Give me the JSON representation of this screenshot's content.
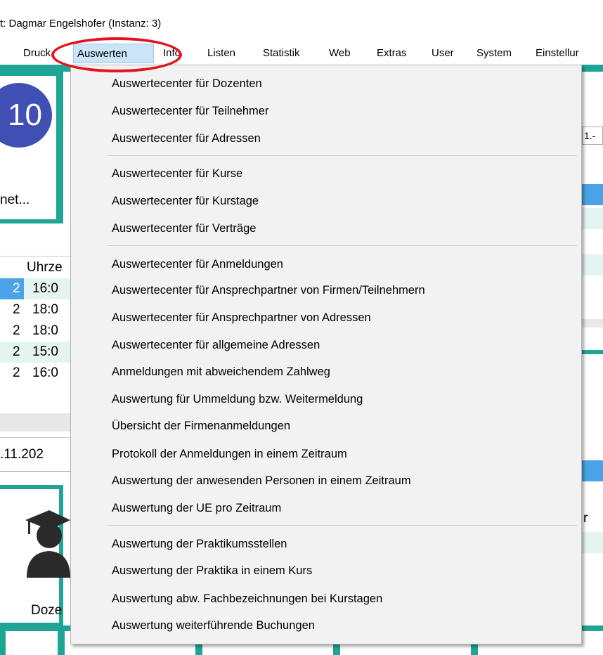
{
  "window": {
    "title": "t: Dagmar Engelshofer (Instanz: 3)"
  },
  "menubar": {
    "items": [
      {
        "label": "Druck"
      },
      {
        "label": "Auswerten"
      },
      {
        "label": "Info"
      },
      {
        "label": "Listen"
      },
      {
        "label": "Statistik"
      },
      {
        "label": "Web"
      },
      {
        "label": "Extras"
      },
      {
        "label": "User"
      },
      {
        "label": "System"
      },
      {
        "label": "Einstellur"
      }
    ]
  },
  "background": {
    "badge_number": "10",
    "tile_label": "net...",
    "table_header": "Uhrze",
    "row_markers": [
      "2",
      "2",
      "2",
      "2",
      "2"
    ],
    "row_times": [
      "16:0",
      "18:0",
      "18:0",
      "15:0",
      "16:0"
    ],
    "date_value": ".11.202",
    "right_field": "1.-",
    "right_char": "r",
    "teacher_label": "Doze"
  },
  "dropdown": {
    "groups": [
      [
        "Auswertecenter für Dozenten",
        "Auswertecenter für Teilnehmer",
        "Auswertecenter für Adressen"
      ],
      [
        "Auswertecenter für Kurse",
        "Auswertecenter für Kurstage",
        "Auswertecenter für Verträge"
      ],
      [
        "Auswertecenter für Anmeldungen",
        "Auswertecenter für Ansprechpartner von Firmen/Teilnehmern",
        "Auswertecenter für Ansprechpartner von Adressen",
        "Auswertecenter für allgemeine Adressen",
        "Anmeldungen mit abweichendem Zahlweg",
        "Auswertung für Ummeldung bzw. Weitermeldung",
        "Übersicht der Firmenanmeldungen",
        "Protokoll der Anmeldungen in einem Zeitraum",
        "Auswertung der anwesenden Personen in einem Zeitraum",
        "Auswertung der UE pro Zeitraum"
      ],
      [
        "Auswertung der Praktikumsstellen",
        "Auswertung der Praktika in einem Kurs",
        "Auswertung abw. Fachbezeichnungen bei Kurstagen",
        "Auswertung weiterführende Buchungen"
      ]
    ]
  },
  "colors": {
    "accent_teal": "#1fa595",
    "badge_blue": "#3f4fb3",
    "highlight_red": "#e3141c",
    "menu_active_bg": "#cce4f7",
    "row_highlight": "#e3f4f1",
    "selected_blue": "#4aa3e6"
  }
}
